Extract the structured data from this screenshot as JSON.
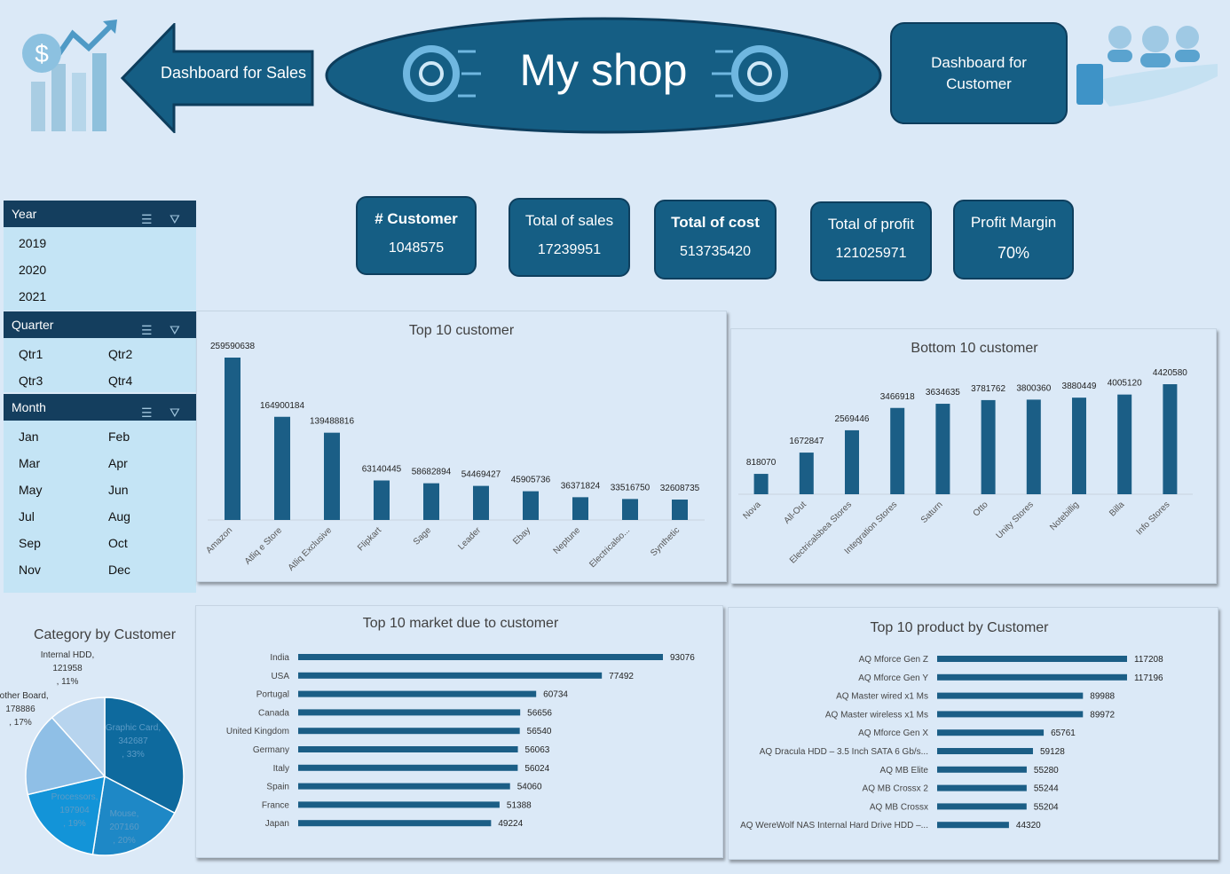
{
  "header": {
    "sales_nav_label": "Dashboard for Sales",
    "title": "My shop",
    "customer_nav_label": "Dashboard for Customer"
  },
  "kpis": [
    {
      "label": "# Customer",
      "value": "1048575"
    },
    {
      "label": "Total of sales",
      "value": "17239951"
    },
    {
      "label": "Total of cost",
      "value": "513735420"
    },
    {
      "label": "Total of profit",
      "value": "121025971"
    },
    {
      "label": "Profit Margin",
      "value": "70%"
    }
  ],
  "slicers": {
    "year": {
      "title": "Year",
      "items": [
        "2019",
        "2020",
        "2021"
      ]
    },
    "quarter": {
      "title": "Quarter",
      "items": [
        "Qtr1",
        "Qtr2",
        "Qtr3",
        "Qtr4"
      ]
    },
    "month": {
      "title": "Month",
      "items": [
        "Jan",
        "Feb",
        "Mar",
        "Apr",
        "May",
        "Jun",
        "Jul",
        "Aug",
        "Sep",
        "Oct",
        "Nov",
        "Dec"
      ]
    }
  },
  "colors": {
    "bar": "#1b5e86",
    "pie": [
      "#0e6a9e",
      "#1e88c6",
      "#1394d8",
      "#8fbfe6",
      "#b7d4ee"
    ]
  },
  "chart_data": [
    {
      "type": "bar",
      "title": "Top 10 customer",
      "categories": [
        "Amazon",
        "Atliq e Store",
        "Atliq Exclusive",
        "Flipkart",
        "Sage",
        "Leader",
        "Ebay",
        "Neptune",
        "Electricalso...",
        "Synthetic"
      ],
      "values": [
        259590638,
        164900184,
        139488816,
        63140445,
        58682894,
        54469427,
        45905736,
        36371824,
        33516750,
        32608735
      ]
    },
    {
      "type": "bar",
      "title": "Bottom 10 customer",
      "categories": [
        "Nova",
        "All-Out",
        "Electricalsbea Stores",
        "Integration Stores",
        "Saturn",
        "Otto",
        "Unity Stores",
        "Notebillig",
        "Billa",
        "Info Stores"
      ],
      "values": [
        818070,
        1672847,
        2569446,
        3466918,
        3634635,
        3781762,
        3800360,
        3880449,
        4005120,
        4420580
      ]
    },
    {
      "type": "pie",
      "title": "Category by Customer",
      "slices": [
        {
          "name": "Graphic Card",
          "value": 342687,
          "pct": "33%"
        },
        {
          "name": "Mouse",
          "value": 207160,
          "pct": "20%"
        },
        {
          "name": "Processors",
          "value": 197904,
          "pct": "19%"
        },
        {
          "name": "Mother Board",
          "value": 178886,
          "pct": "17%"
        },
        {
          "name": "Internal HDD",
          "value": 121958,
          "pct": "11%"
        }
      ]
    },
    {
      "type": "bar",
      "orientation": "horizontal",
      "title": "Top 10 market due to customer",
      "categories": [
        "India",
        "USA",
        "Portugal",
        "Canada",
        "United Kingdom",
        "Germany",
        "Italy",
        "Spain",
        "France",
        "Japan"
      ],
      "values": [
        93076,
        77492,
        60734,
        56656,
        56540,
        56063,
        56024,
        54060,
        51388,
        49224
      ]
    },
    {
      "type": "bar",
      "orientation": "horizontal",
      "title": "Top 10 product by Customer",
      "categories": [
        "AQ Mforce Gen Z",
        "AQ Mforce Gen Y",
        "AQ Master wired x1 Ms",
        "AQ Master wireless x1 Ms",
        "AQ Mforce Gen X",
        "AQ Dracula HDD – 3.5 Inch SATA 6 Gb/s...",
        "AQ MB Elite",
        "AQ MB Crossx 2",
        "AQ MB Crossx",
        "AQ WereWolf NAS Internal Hard Drive HDD –..."
      ],
      "values": [
        117208,
        117196,
        89988,
        89972,
        65761,
        59128,
        55280,
        55244,
        55204,
        44320
      ]
    }
  ]
}
